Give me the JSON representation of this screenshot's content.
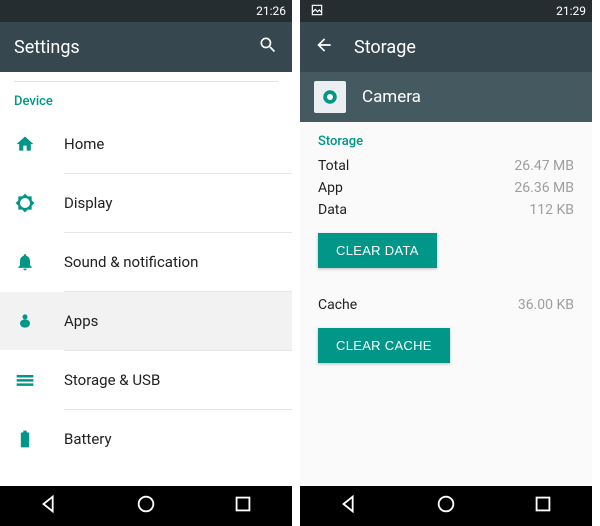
{
  "colors": {
    "accent": "#009688",
    "appbar": "#37474f",
    "subheader": "#455a60"
  },
  "left": {
    "status": {
      "time": "21:26"
    },
    "appbar": {
      "title": "Settings"
    },
    "section": "Device",
    "items": [
      {
        "icon": "home-icon",
        "label": "Home",
        "selected": false
      },
      {
        "icon": "brightness-icon",
        "label": "Display",
        "selected": false
      },
      {
        "icon": "bell-icon",
        "label": "Sound & notification",
        "selected": false
      },
      {
        "icon": "apps-icon",
        "label": "Apps",
        "selected": true
      },
      {
        "icon": "storage-icon",
        "label": "Storage & USB",
        "selected": false
      },
      {
        "icon": "battery-icon",
        "label": "Battery",
        "selected": false
      }
    ]
  },
  "right": {
    "status": {
      "time": "21:29"
    },
    "appbar": {
      "title": "Storage"
    },
    "app": {
      "name": "Camera"
    },
    "storage": {
      "section": "Storage",
      "total_label": "Total",
      "total_value": "26.47 MB",
      "app_label": "App",
      "app_value": "26.36 MB",
      "data_label": "Data",
      "data_value": "112 KB",
      "clear_data_btn": "CLEAR DATA",
      "cache_label": "Cache",
      "cache_value": "36.00 KB",
      "clear_cache_btn": "CLEAR CACHE"
    }
  }
}
